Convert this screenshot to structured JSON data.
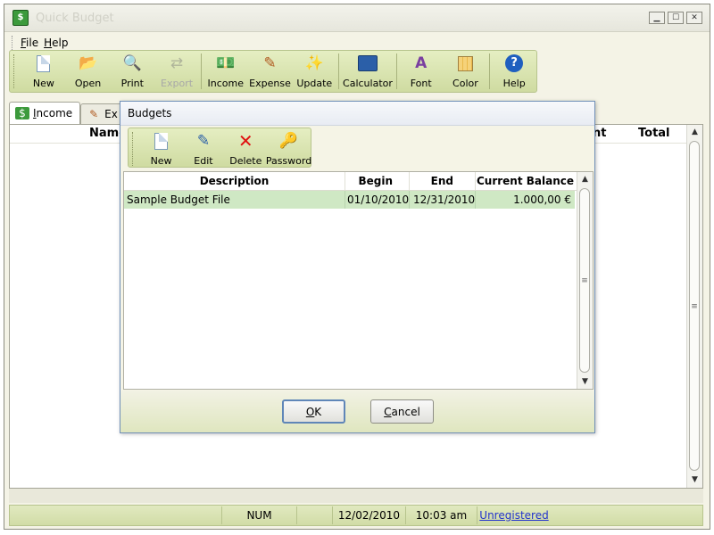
{
  "window": {
    "title": "Quick Budget",
    "controls": [
      "minimize",
      "maximize",
      "close"
    ]
  },
  "menu": [
    {
      "label": "File",
      "accel": "F",
      "rest": "ile"
    },
    {
      "label": "Help",
      "accel": "H",
      "rest": "elp"
    }
  ],
  "toolbar": {
    "new": "New",
    "open": "Open",
    "print": "Print",
    "export": "Export",
    "income": "Income",
    "expense": "Expense",
    "update": "Update",
    "calculator": "Calculator",
    "font": "Font",
    "color": "Color",
    "help": "Help"
  },
  "tabs": [
    {
      "label": "Income",
      "accel": "I",
      "rest": "ncome",
      "active": true
    },
    {
      "label": "Ex",
      "active": false
    }
  ],
  "main_table": {
    "headers": {
      "name": "Name",
      "amount_partial": "nt",
      "total": "Total"
    }
  },
  "dialog": {
    "title": "Budgets",
    "toolbar": {
      "new": "New",
      "edit": "Edit",
      "delete": "Delete",
      "password": "Password"
    },
    "columns": [
      "Description",
      "Begin",
      "End",
      "Current Balance"
    ],
    "rows": [
      {
        "description": "Sample Budget File",
        "begin": "01/10/2010",
        "end": "12/31/2010",
        "balance": "1.000,00 €",
        "selected": true
      }
    ],
    "ok": {
      "accel": "O",
      "rest": "K"
    },
    "cancel": {
      "accel": "C",
      "rest": "ancel"
    }
  },
  "status": {
    "num": "NUM",
    "date": "12/02/2010",
    "time": "10:03 am",
    "registration": "Unregistered"
  },
  "colors": {
    "toolbar_green": "#d8e3ae",
    "selected_row": "#cfe8c4",
    "link": "#2233cc"
  }
}
